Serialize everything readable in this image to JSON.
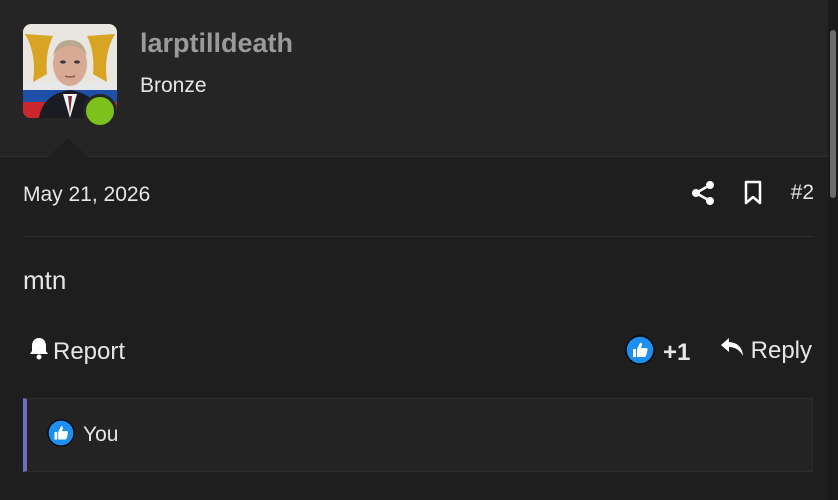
{
  "user": {
    "username": "larptilldeath",
    "rank": "Bronze",
    "online": true
  },
  "post": {
    "date": "May 21, 2026",
    "number": "#2",
    "body": "mtn"
  },
  "actions": {
    "report_label": "Report",
    "reaction_count": "+1",
    "reply_label": "Reply"
  },
  "reaction_summary": {
    "users": "You"
  },
  "icons": {
    "share": "share-icon",
    "bookmark": "bookmark-icon",
    "bell": "bell-icon",
    "like": "like-icon",
    "reply": "reply-icon"
  },
  "colors": {
    "background": "#1e1e1e",
    "header_bg": "#252525",
    "username": "#9a9a9a",
    "online": "#7cc11c",
    "like_blue": "#1d8ff0",
    "reaction_bar_accent": "#6a6fc4"
  }
}
